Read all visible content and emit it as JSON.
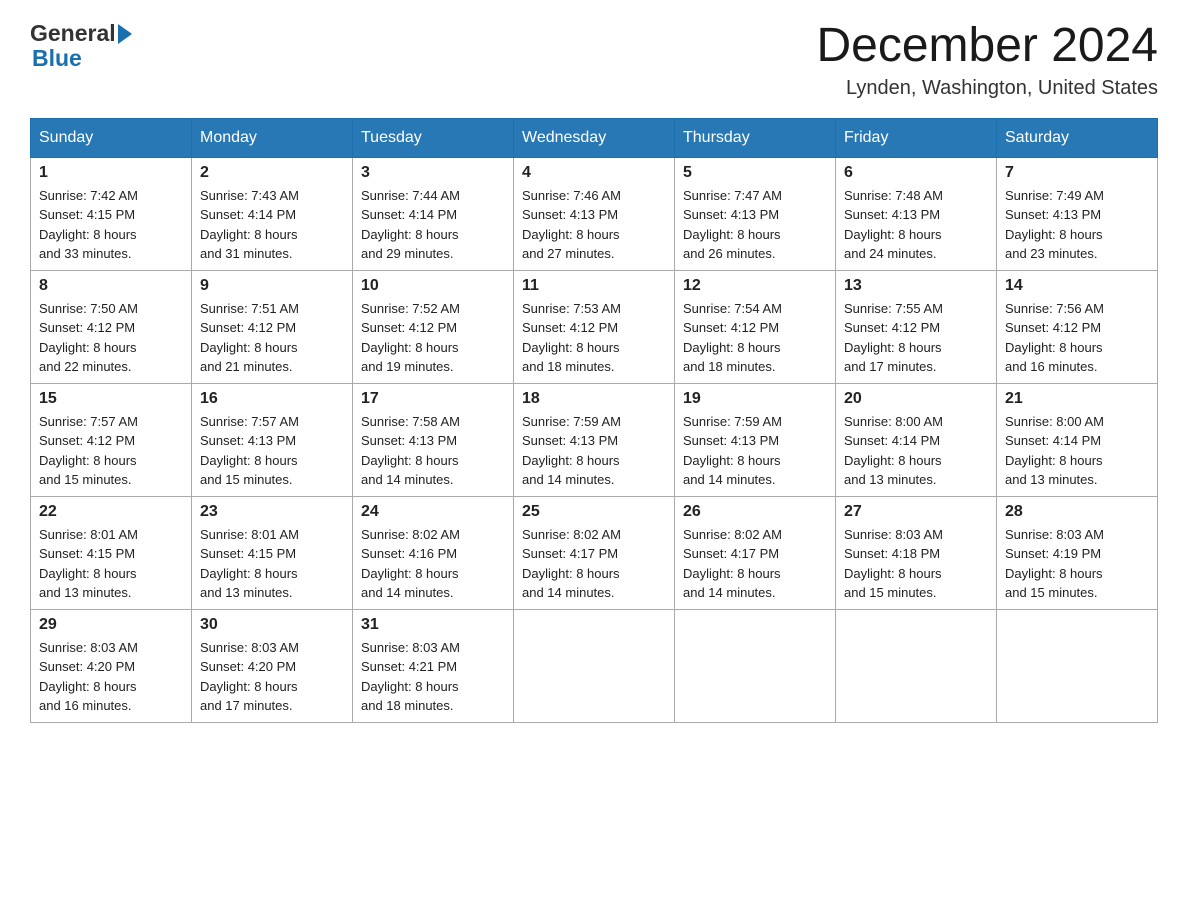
{
  "header": {
    "logo_general": "General",
    "logo_blue": "Blue",
    "title": "December 2024",
    "subtitle": "Lynden, Washington, United States"
  },
  "days_of_week": [
    "Sunday",
    "Monday",
    "Tuesday",
    "Wednesday",
    "Thursday",
    "Friday",
    "Saturday"
  ],
  "weeks": [
    [
      {
        "day": "1",
        "sunrise": "7:42 AM",
        "sunset": "4:15 PM",
        "daylight": "8 hours and 33 minutes."
      },
      {
        "day": "2",
        "sunrise": "7:43 AM",
        "sunset": "4:14 PM",
        "daylight": "8 hours and 31 minutes."
      },
      {
        "day": "3",
        "sunrise": "7:44 AM",
        "sunset": "4:14 PM",
        "daylight": "8 hours and 29 minutes."
      },
      {
        "day": "4",
        "sunrise": "7:46 AM",
        "sunset": "4:13 PM",
        "daylight": "8 hours and 27 minutes."
      },
      {
        "day": "5",
        "sunrise": "7:47 AM",
        "sunset": "4:13 PM",
        "daylight": "8 hours and 26 minutes."
      },
      {
        "day": "6",
        "sunrise": "7:48 AM",
        "sunset": "4:13 PM",
        "daylight": "8 hours and 24 minutes."
      },
      {
        "day": "7",
        "sunrise": "7:49 AM",
        "sunset": "4:13 PM",
        "daylight": "8 hours and 23 minutes."
      }
    ],
    [
      {
        "day": "8",
        "sunrise": "7:50 AM",
        "sunset": "4:12 PM",
        "daylight": "8 hours and 22 minutes."
      },
      {
        "day": "9",
        "sunrise": "7:51 AM",
        "sunset": "4:12 PM",
        "daylight": "8 hours and 21 minutes."
      },
      {
        "day": "10",
        "sunrise": "7:52 AM",
        "sunset": "4:12 PM",
        "daylight": "8 hours and 19 minutes."
      },
      {
        "day": "11",
        "sunrise": "7:53 AM",
        "sunset": "4:12 PM",
        "daylight": "8 hours and 18 minutes."
      },
      {
        "day": "12",
        "sunrise": "7:54 AM",
        "sunset": "4:12 PM",
        "daylight": "8 hours and 18 minutes."
      },
      {
        "day": "13",
        "sunrise": "7:55 AM",
        "sunset": "4:12 PM",
        "daylight": "8 hours and 17 minutes."
      },
      {
        "day": "14",
        "sunrise": "7:56 AM",
        "sunset": "4:12 PM",
        "daylight": "8 hours and 16 minutes."
      }
    ],
    [
      {
        "day": "15",
        "sunrise": "7:57 AM",
        "sunset": "4:12 PM",
        "daylight": "8 hours and 15 minutes."
      },
      {
        "day": "16",
        "sunrise": "7:57 AM",
        "sunset": "4:13 PM",
        "daylight": "8 hours and 15 minutes."
      },
      {
        "day": "17",
        "sunrise": "7:58 AM",
        "sunset": "4:13 PM",
        "daylight": "8 hours and 14 minutes."
      },
      {
        "day": "18",
        "sunrise": "7:59 AM",
        "sunset": "4:13 PM",
        "daylight": "8 hours and 14 minutes."
      },
      {
        "day": "19",
        "sunrise": "7:59 AM",
        "sunset": "4:13 PM",
        "daylight": "8 hours and 14 minutes."
      },
      {
        "day": "20",
        "sunrise": "8:00 AM",
        "sunset": "4:14 PM",
        "daylight": "8 hours and 13 minutes."
      },
      {
        "day": "21",
        "sunrise": "8:00 AM",
        "sunset": "4:14 PM",
        "daylight": "8 hours and 13 minutes."
      }
    ],
    [
      {
        "day": "22",
        "sunrise": "8:01 AM",
        "sunset": "4:15 PM",
        "daylight": "8 hours and 13 minutes."
      },
      {
        "day": "23",
        "sunrise": "8:01 AM",
        "sunset": "4:15 PM",
        "daylight": "8 hours and 13 minutes."
      },
      {
        "day": "24",
        "sunrise": "8:02 AM",
        "sunset": "4:16 PM",
        "daylight": "8 hours and 14 minutes."
      },
      {
        "day": "25",
        "sunrise": "8:02 AM",
        "sunset": "4:17 PM",
        "daylight": "8 hours and 14 minutes."
      },
      {
        "day": "26",
        "sunrise": "8:02 AM",
        "sunset": "4:17 PM",
        "daylight": "8 hours and 14 minutes."
      },
      {
        "day": "27",
        "sunrise": "8:03 AM",
        "sunset": "4:18 PM",
        "daylight": "8 hours and 15 minutes."
      },
      {
        "day": "28",
        "sunrise": "8:03 AM",
        "sunset": "4:19 PM",
        "daylight": "8 hours and 15 minutes."
      }
    ],
    [
      {
        "day": "29",
        "sunrise": "8:03 AM",
        "sunset": "4:20 PM",
        "daylight": "8 hours and 16 minutes."
      },
      {
        "day": "30",
        "sunrise": "8:03 AM",
        "sunset": "4:20 PM",
        "daylight": "8 hours and 17 minutes."
      },
      {
        "day": "31",
        "sunrise": "8:03 AM",
        "sunset": "4:21 PM",
        "daylight": "8 hours and 18 minutes."
      },
      null,
      null,
      null,
      null
    ]
  ],
  "labels": {
    "sunrise": "Sunrise: ",
    "sunset": "Sunset: ",
    "daylight": "Daylight: "
  }
}
